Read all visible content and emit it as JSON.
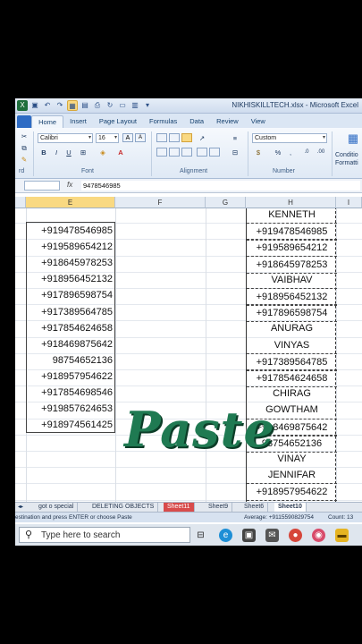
{
  "window": {
    "title": "NIKHISKILLTECH.xlsx - Microsoft Excel"
  },
  "tabs": [
    "Home",
    "Insert",
    "Page Layout",
    "Formulas",
    "Data",
    "Review",
    "View"
  ],
  "ribbon": {
    "font_name": "Calibri",
    "font_size": "16",
    "number_format": "Custom",
    "font_group": "Font",
    "alignment_group": "Alignment",
    "number_group": "Number",
    "clipboard_group": "rd",
    "conditional_label_1": "Conditio",
    "conditional_label_2": "Formatti",
    "bold": "B",
    "italic": "I",
    "underline": "U",
    "percent": "%",
    "comma": ","
  },
  "formula_bar": {
    "fx": "fx",
    "value": "9478546985"
  },
  "columns": [
    "E",
    "F",
    "G",
    "H",
    "I"
  ],
  "column_e": [
    "+919478546985",
    "+919589654212",
    "+918645978253",
    "+918956452132",
    "+917896598754",
    "+917389564785",
    "+917854624658",
    "+918469875642",
    "98754652136",
    "+918957954622",
    "+917854698546",
    "+919857624653",
    "+918974561425"
  ],
  "column_h": [
    {
      "text": "KENNETH",
      "kind": "name"
    },
    {
      "text": "+919478546985",
      "kind": "num"
    },
    {
      "text": "+919589654212",
      "kind": "num"
    },
    {
      "text": "+918645978253",
      "kind": "num"
    },
    {
      "text": "VAIBHAV",
      "kind": "name"
    },
    {
      "text": "+918956452132",
      "kind": "num"
    },
    {
      "text": "+917896598754",
      "kind": "num"
    },
    {
      "text": "ANURAG",
      "kind": "name"
    },
    {
      "text": "VINYAS",
      "kind": "name"
    },
    {
      "text": "+917389564785",
      "kind": "num"
    },
    {
      "text": "+917854624658",
      "kind": "num"
    },
    {
      "text": "CHIRAG",
      "kind": "name"
    },
    {
      "text": "GOWTHAM",
      "kind": "name"
    },
    {
      "text": "+918469875642",
      "kind": "num"
    },
    {
      "text": "98754652136",
      "kind": "num"
    },
    {
      "text": "VINAY",
      "kind": "name"
    },
    {
      "text": "JENNIFAR",
      "kind": "name"
    },
    {
      "text": "+918957954622",
      "kind": "num"
    }
  ],
  "overlay_text": "Paste",
  "sheet_tabs": [
    {
      "label": "got o special",
      "state": "normal"
    },
    {
      "label": "DELETING OBJECTS",
      "state": "normal"
    },
    {
      "label": "Sheet11",
      "state": "red"
    },
    {
      "label": "Sheet9",
      "state": "normal"
    },
    {
      "label": "Sheet6",
      "state": "normal"
    },
    {
      "label": "Sheet10",
      "state": "active"
    }
  ],
  "status": {
    "message": "estination and press ENTER or choose Paste",
    "average": "Average: +9115590829754",
    "count": "Count: 13"
  },
  "taskbar": {
    "search_placeholder": "Type here to search"
  },
  "colors": {
    "paste_green": "#1f7a52",
    "excel_blue": "#2d6bc4",
    "selected_col": "#f9d982"
  }
}
